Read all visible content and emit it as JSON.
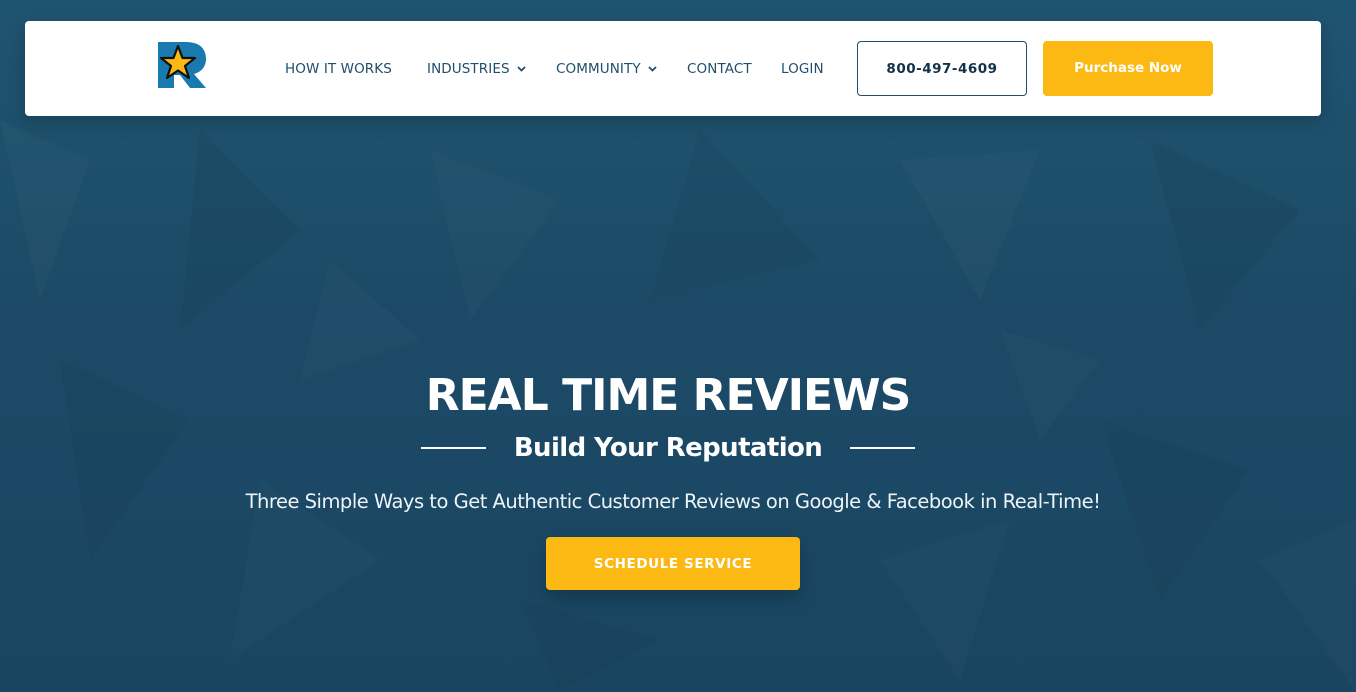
{
  "colors": {
    "background": "#1d4a66",
    "nav_text": "#1f4e6b",
    "accent": "#fdb913",
    "phone_text": "#12324a"
  },
  "nav": {
    "logo_icon": "r-star-logo-icon",
    "items": [
      {
        "label": "HOW IT WORKS",
        "has_dropdown": false
      },
      {
        "label": "INDUSTRIES",
        "has_dropdown": true
      },
      {
        "label": "COMMUNITY",
        "has_dropdown": true
      },
      {
        "label": "CONTACT",
        "has_dropdown": false
      },
      {
        "label": "LOGIN",
        "has_dropdown": false
      }
    ],
    "phone_label": "800-497-4609",
    "purchase_label": "Purchase Now"
  },
  "hero": {
    "title": "REAL TIME REVIEWS",
    "subtitle": "Build Your Reputation",
    "tagline": "Three Simple Ways to Get Authentic Customer Reviews on Google & Facebook in Real-Time!",
    "cta_label": "SCHEDULE SERVICE"
  }
}
